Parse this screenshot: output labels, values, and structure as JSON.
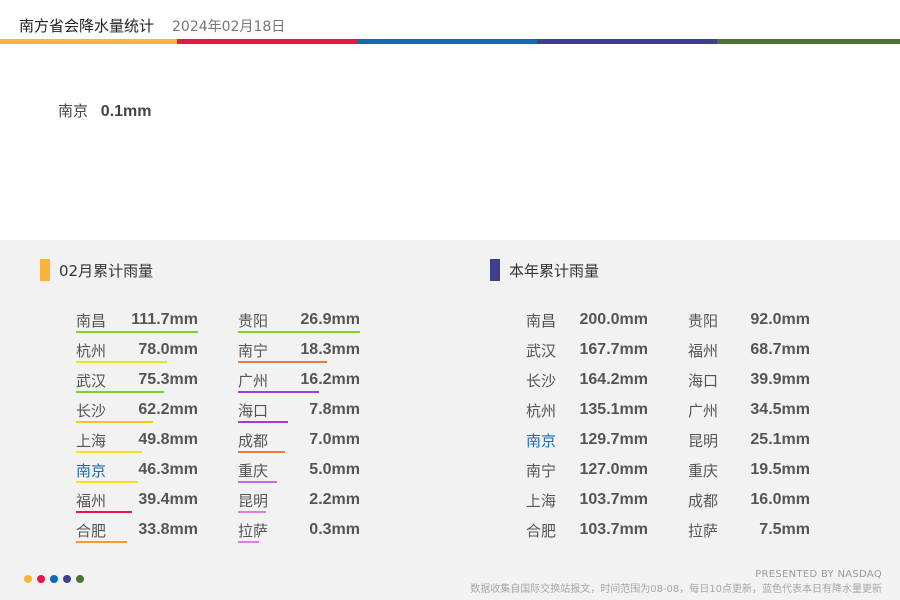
{
  "header": {
    "title": "南方省会降水量统计",
    "date": "2024年02月18日",
    "strip_colors": [
      "#fbb33a",
      "#e8174a",
      "#0f6bb3",
      "#3f3e8f",
      "#4a7436"
    ]
  },
  "today": {
    "city": "南京",
    "value": "0.1mm"
  },
  "month_section": {
    "title": "02月累计雨量",
    "marker_color": "#fbb33a",
    "items": [
      {
        "city": "南昌",
        "value": "111.7mm",
        "color": "#7ed321",
        "level": 1.0
      },
      {
        "city": "杭州",
        "value": "78.0mm",
        "color": "#e6e620",
        "level": 0.7
      },
      {
        "city": "武汉",
        "value": "75.3mm",
        "color": "#7ed321",
        "level": 0.67
      },
      {
        "city": "长沙",
        "value": "62.2mm",
        "color": "#f5c518",
        "level": 0.56
      },
      {
        "city": "上海",
        "value": "49.8mm",
        "color": "#f5e11b",
        "level": 0.45
      },
      {
        "city": "南京",
        "value": "46.3mm",
        "color": "#f5e11b",
        "level": 0.41,
        "highlight": true
      },
      {
        "city": "福州",
        "value": "39.4mm",
        "color": "#e8174a",
        "level": 0.35
      },
      {
        "city": "合肥",
        "value": "33.8mm",
        "color": "#f79a2b",
        "level": 0.3
      },
      {
        "city": "贵阳",
        "value": "26.9mm",
        "color": "#7ed321",
        "level": 1.0
      },
      {
        "city": "南宁",
        "value": "18.3mm",
        "color": "#f07a3a",
        "level": 0.68
      },
      {
        "city": "广州",
        "value": "16.2mm",
        "color": "#9b3fd6",
        "level": 0.6
      },
      {
        "city": "海口",
        "value": "7.8mm",
        "color": "#9b3fd6",
        "level": 0.29
      },
      {
        "city": "成都",
        "value": "7.0mm",
        "color": "#f07a3a",
        "level": 0.26
      },
      {
        "city": "重庆",
        "value": "5.0mm",
        "color": "#cc66ee",
        "level": 0.19
      },
      {
        "city": "昆明",
        "value": "2.2mm",
        "color": "#e07ae8",
        "level": 0.08
      },
      {
        "city": "拉萨",
        "value": "0.3mm",
        "color": "#e07ae8",
        "level": 0.01
      }
    ]
  },
  "year_section": {
    "title": "本年累计雨量",
    "marker_color": "#3f3e8f",
    "items": [
      {
        "city": "南昌",
        "value": "200.0mm"
      },
      {
        "city": "武汉",
        "value": "167.7mm"
      },
      {
        "city": "长沙",
        "value": "164.2mm"
      },
      {
        "city": "杭州",
        "value": "135.1mm"
      },
      {
        "city": "南京",
        "value": "129.7mm",
        "highlight": true
      },
      {
        "city": "南宁",
        "value": "127.0mm"
      },
      {
        "city": "上海",
        "value": "103.7mm"
      },
      {
        "city": "合肥",
        "value": "103.7mm"
      },
      {
        "city": "贵阳",
        "value": "92.0mm"
      },
      {
        "city": "福州",
        "value": "68.7mm"
      },
      {
        "city": "海口",
        "value": "39.9mm"
      },
      {
        "city": "广州",
        "value": "34.5mm"
      },
      {
        "city": "昆明",
        "value": "25.1mm"
      },
      {
        "city": "重庆",
        "value": "19.5mm"
      },
      {
        "city": "成都",
        "value": "16.0mm"
      },
      {
        "city": "拉萨",
        "value": "7.5mm"
      }
    ]
  },
  "footer": {
    "dot_colors": [
      "#fbb33a",
      "#e8174a",
      "#0f6bb3",
      "#3f3e8f",
      "#4a7436"
    ],
    "brand": "PRESENTED BY NASDAQ",
    "note": "数据收集自国际交换站报文，时间范围为08-08，每日10点更新，蓝色代表本日有降水量更新"
  }
}
